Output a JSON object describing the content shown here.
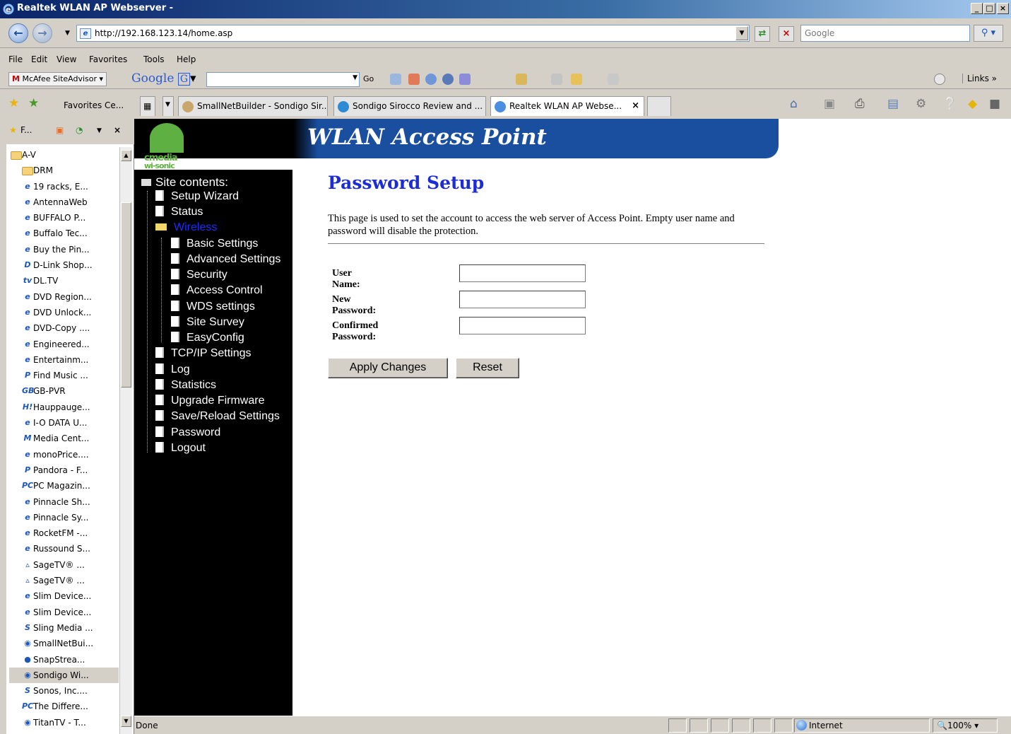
{
  "window": {
    "title": "Realtek WLAN AP Webserver -"
  },
  "address": {
    "url": "http://192.168.123.14/home.asp",
    "search_placeholder": "Google"
  },
  "menu": [
    "File",
    "Edit",
    "View",
    "Favorites",
    "Tools",
    "Help"
  ],
  "toolbar": {
    "mcafee_label": "McAfee SiteAdvisor",
    "mcafee_m": "M",
    "google_label": "Google",
    "go_label": "Go",
    "links_label": "Links"
  },
  "favbar": {
    "favorites_center": "Favorites Ce..."
  },
  "tabs": [
    {
      "label": "SmallNetBuilder - Sondigo Sir..."
    },
    {
      "label": "Sondigo Sirocco Review and ..."
    },
    {
      "label": "Realtek WLAN AP Webse..."
    }
  ],
  "favpane": {
    "header": "F...",
    "folder": "A-V",
    "items": [
      "DRM",
      "19 racks, E...",
      "AntennaWeb",
      "BUFFALO P...",
      "Buffalo Tec...",
      "Buy the Pin...",
      "D-Link Shop...",
      "DL.TV",
      "DVD Region...",
      "DVD Unlock...",
      "DVD-Copy ....",
      "Engineered...",
      "Entertainm...",
      "Find Music ...",
      "GB-PVR",
      "Hauppauge...",
      "I-O DATA U...",
      "Media Cent...",
      "monoPrice....",
      "Pandora - F...",
      "PC Magazin...",
      "Pinnacle Sh...",
      "Pinnacle Sy...",
      "RocketFM -...",
      "Russound S...",
      "SageTV® ...",
      "SageTV® ...",
      "Slim Device...",
      "Slim Device...",
      "Sling Media ...",
      "SmallNetBui...",
      "SnapStrea...",
      "Sondigo Wi...",
      "Sonos, Inc....",
      "The Differe...",
      "TitanTV - T..."
    ],
    "icons": [
      "folder-icon",
      "ie-page-icon",
      "ie-page-icon",
      "ie-page-icon",
      "ie-page-icon",
      "ie-page-icon",
      "dlink-icon",
      "dltv-icon",
      "ie-page-icon",
      "ie-page-icon",
      "ie-page-icon",
      "ie-page-icon",
      "ie-page-icon",
      "p-icon",
      "gb-icon",
      "h-icon",
      "ie-page-icon",
      "media-center-icon",
      "ie-page-icon",
      "p-icon",
      "pc-icon",
      "ie-page-icon",
      "ie-page-icon",
      "ie-page-icon",
      "ie-page-icon",
      "sagetv-icon",
      "sagetv-icon",
      "ie-page-icon",
      "ie-page-icon",
      "sling-icon",
      "snb-icon",
      "snapstream-icon",
      "sondigo-icon",
      "sonos-icon",
      "pc-icon",
      "titantv-icon"
    ]
  },
  "header": {
    "title": "WLAN Access Point",
    "logo_line1": "cmedia",
    "logo_line2": "wi-sonic"
  },
  "nav": {
    "site_contents": "Site contents:",
    "items": [
      "Setup Wizard",
      "Status",
      "Wireless",
      "Basic Settings",
      "Advanced Settings",
      "Security",
      "Access Control",
      "WDS settings",
      "Site Survey",
      "EasyConfig",
      "TCP/IP Settings",
      "Log",
      "Statistics",
      "Upgrade Firmware",
      "Save/Reload Settings",
      "Password",
      "Logout"
    ]
  },
  "content": {
    "title": "Password Setup",
    "description": "This page is used to set the account to access the web server of Access Point. Empty user name and password will disable the protection.",
    "fields": [
      {
        "label": "User Name:",
        "value": ""
      },
      {
        "label": "New Password:",
        "value": ""
      },
      {
        "label": "Confirmed Password:",
        "value": ""
      }
    ],
    "apply_label": "Apply Changes",
    "reset_label": "Reset"
  },
  "status": {
    "text": "Done",
    "zone": "Internet",
    "zoom": "100%"
  },
  "colors": {
    "title_blue": "#1c2dd8",
    "header_blue": "#1a4fa0",
    "nav_bg": "#000000",
    "logo_green": "#5fb042"
  }
}
